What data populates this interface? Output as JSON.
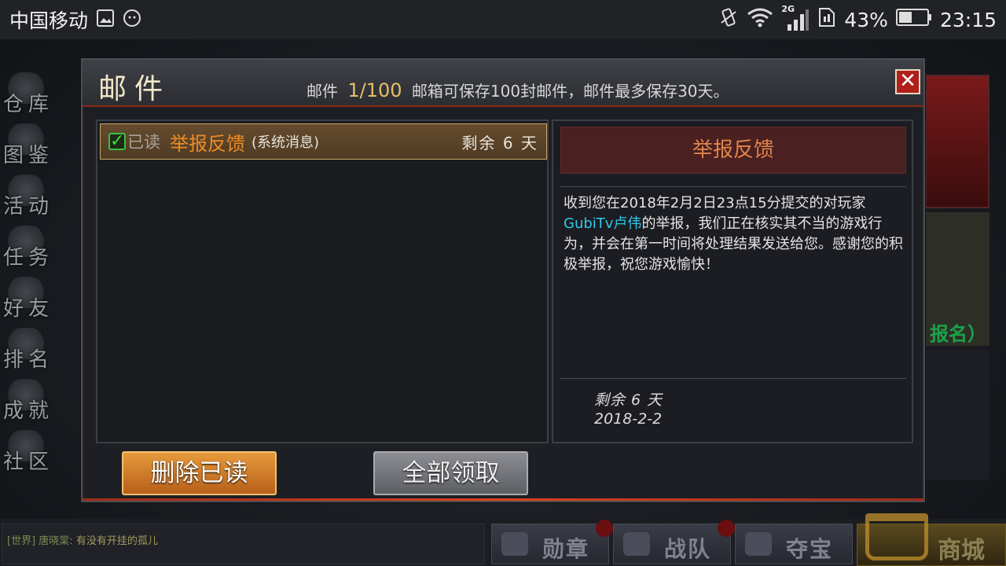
{
  "status_bar": {
    "carrier": "中国移动",
    "network": "2G",
    "battery": "43%",
    "time": "23:15"
  },
  "sidebar": {
    "items": [
      {
        "label": "仓库"
      },
      {
        "label": "图鉴"
      },
      {
        "label": "活动"
      },
      {
        "label": "任务"
      },
      {
        "label": "好友"
      },
      {
        "label": "排名"
      },
      {
        "label": "成就"
      },
      {
        "label": "社区"
      }
    ]
  },
  "background": {
    "signup_label": "报名）"
  },
  "dialog": {
    "title": "邮件",
    "info_label": "邮件",
    "count": "1/100",
    "info_text": "邮箱可保存100封邮件，邮件最多保存30天。",
    "close_symbol": "✕"
  },
  "mail_list": [
    {
      "read_label": "已读",
      "subject": "举报反馈",
      "source": "(系统消息)",
      "expiry": "剩余 6 天"
    }
  ],
  "detail": {
    "title": "举报反馈",
    "body_before": "收到您在2018年2月2日23点15分提交的对玩家",
    "player": "GubiTv卢伟",
    "body_after": "的举报，我们正在核实其不当的游戏行为，并会在第一时间将处理结果发送给您。感谢您的积极举报，祝您游戏愉快！",
    "expiry": "剩余 6 天",
    "date": "2018-2-2"
  },
  "buttons": {
    "delete_read": "删除已读",
    "claim_all": "全部领取"
  },
  "chat": {
    "channel": "[世界]",
    "name": "唐晓棠:",
    "message": "有没有开挂的孤儿"
  },
  "bottom_tabs": [
    {
      "label": "勋章"
    },
    {
      "label": "战队"
    },
    {
      "label": "夺宝"
    }
  ],
  "shop": {
    "label": "商城"
  },
  "colors": {
    "accent_orange": "#ee8c24",
    "player_cyan": "#2fc8e8",
    "close_red": "#b0201b"
  }
}
